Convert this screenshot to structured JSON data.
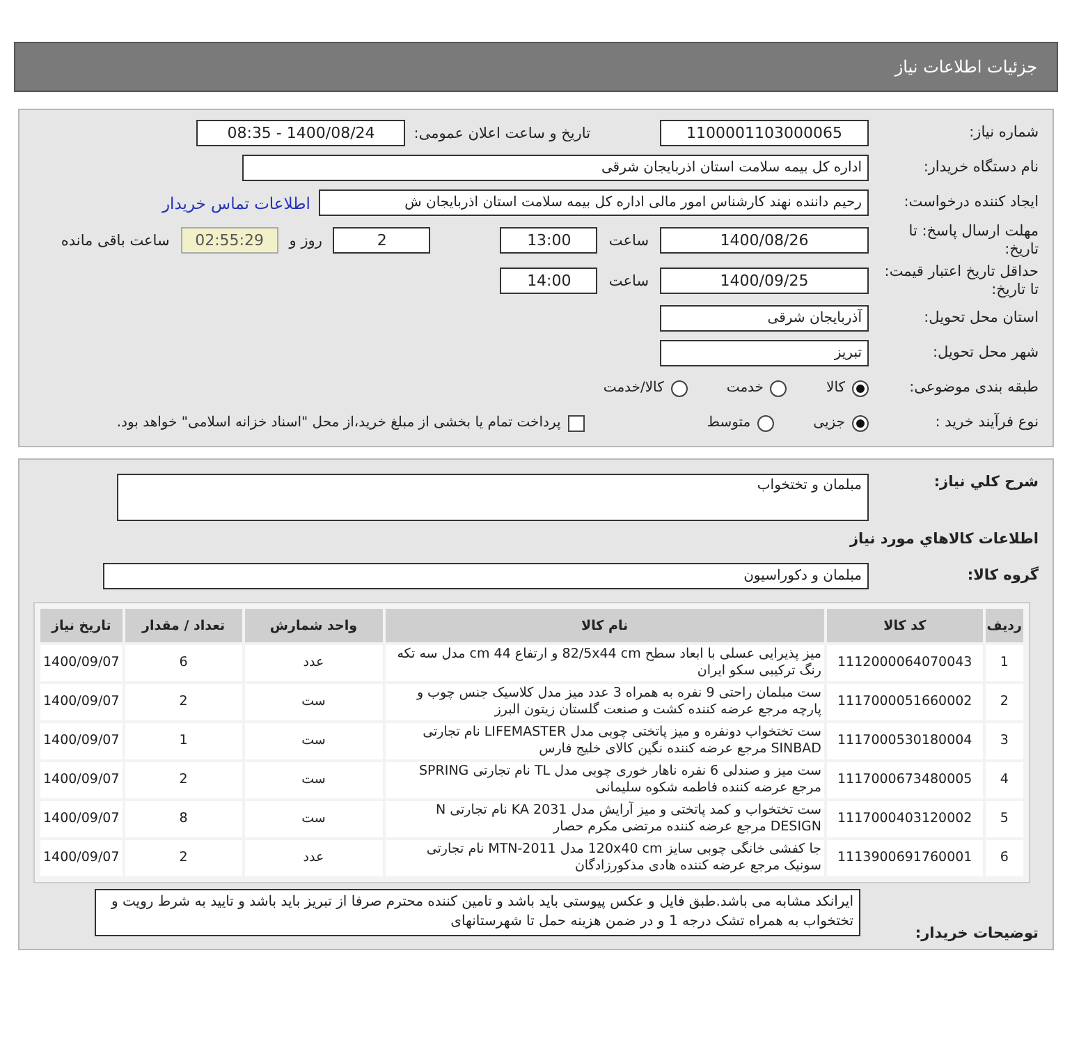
{
  "header": {
    "title": "جزئیات اطلاعات نیاز"
  },
  "form": {
    "need_number_label": "شماره نیاز:",
    "need_number": "1100001103000065",
    "announce_label": "تاریخ و ساعت اعلان عمومی:",
    "announce": "1400/08/24 - 08:35",
    "buyer_label": "نام دستگاه خریدار:",
    "buyer": "اداره کل بیمه سلامت استان اذربایجان شرقی",
    "creator_label": "ایجاد کننده درخواست:",
    "creator": "رحیم  داننده نهند کارشناس امور مالی اداره کل بیمه سلامت استان اذربایجان ش",
    "contact_link": "اطلاعات تماس خریدار",
    "deadline_label": "مهلت ارسال پاسخ: تا تاریخ:",
    "deadline_date": "1400/08/26",
    "time_label": "ساعت",
    "deadline_time": "13:00",
    "days": "2",
    "days_label": "روز و",
    "remaining": "02:55:29",
    "remaining_label": "ساعت باقی مانده",
    "validity_label": "حداقل تاریخ اعتبار قیمت: تا تاریخ:",
    "validity_date": "1400/09/25",
    "validity_time_label": "ساعت",
    "validity_time": "14:00",
    "province_label": "استان محل تحویل:",
    "province": "آذربایجان شرقی",
    "city_label": "شهر محل تحویل:",
    "city": "تبریز",
    "category_label": "طبقه بندی موضوعی:",
    "category_options": [
      {
        "label": "کالا",
        "selected": true
      },
      {
        "label": "خدمت",
        "selected": false
      },
      {
        "label": "کالا/خدمت",
        "selected": false
      }
    ],
    "process_label": "نوع فرآیند خرید :",
    "process_options": [
      {
        "label": "جزیی",
        "selected": true
      },
      {
        "label": "متوسط",
        "selected": false
      }
    ],
    "payment": {
      "label": "پرداخت تمام یا بخشی از مبلغ خرید،از محل \"اسناد خزانه اسلامی\" خواهد بود.",
      "checked": false
    }
  },
  "details": {
    "description_label": "شرح کلي نياز:",
    "description": "مبلمان و تختخواب",
    "goods_heading": "اطلاعات کالاهاي مورد نياز",
    "group_label": "گروه کالا:",
    "group": "مبلمان و دکوراسيون",
    "table": {
      "columns": [
        "ردیف",
        "کد کالا",
        "نام کالا",
        "واحد شمارش",
        "تعداد / مقدار",
        "تاریخ نیاز"
      ],
      "rows": [
        [
          "1",
          "1112000064070043",
          "میز پذیرایی عسلی با ابعاد سطح 82/5x44 cm و ارتفاع 44 cm مدل سه تکه رنگ ترکیبی سکو ایران",
          "عدد",
          "6",
          "1400/09/07"
        ],
        [
          "2",
          "1117000051660002",
          "ست مبلمان راحتی 9 نفره به همراه 3 عدد میز مدل کلاسیک جنس چوب و پارچه مرجع عرضه کننده کشت و صنعت گلستان زیتون البرز",
          "ست",
          "2",
          "1400/09/07"
        ],
        [
          "3",
          "1117000530180004",
          "ست تختخواب دونفره و میز پاتختی چوبی مدل LIFEMASTER نام تجارتی SINBAD مرجع عرضه کننده نگین کالای خلیج فارس",
          "ست",
          "1",
          "1400/09/07"
        ],
        [
          "4",
          "1117000673480005",
          "ست میز و صندلی 6 نفره ناهار خوری چوبی مدل TL نام تجارتی SPRING مرجع عرضه کننده فاطمه شکوه سلیمانی",
          "ست",
          "2",
          "1400/09/07"
        ],
        [
          "5",
          "1117000403120002",
          "ست تختخواب و کمد پاتختی و میز آرایش مدل KA 2031 نام تجارتی N DESIGN مرجع عرضه کننده مرتضی مکرم حصار",
          "ست",
          "8",
          "1400/09/07"
        ],
        [
          "6",
          "1113900691760001",
          "جا کفشی خانگی چوبی سایز 120x40 cm مدل MTN-2011 نام تجارتی سونیک مرجع عرضه کننده هادی مذکورزادگان",
          "عدد",
          "2",
          "1400/09/07"
        ]
      ]
    },
    "notes_label": "توضیحات خریدار:",
    "notes": "ایرانکد مشابه می باشد.طبق فایل و عکس پیوستی باید باشد و تامین کننده محترم صرفا از تبریز باید باشد و تایید به شرط  رویت و تختخواب به همراه تشک درجه 1 و در ضمن هزینه حمل تا شهرستانهای"
  }
}
